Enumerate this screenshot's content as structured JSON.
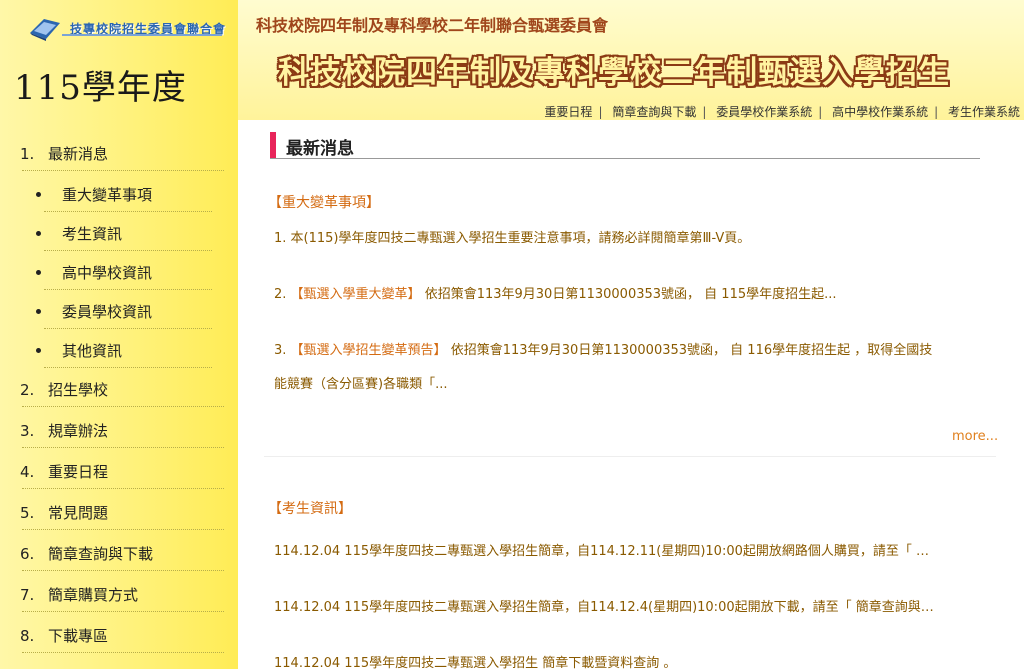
{
  "header": {
    "logo_text": "技專校院招生委員會聯合會",
    "org_title": "科技校院四年制及專科學校二年制聯合甄選委員會",
    "main_title": "科技校院四年制及專科學校二年制甄選入學招生",
    "top_links": [
      "重要日程",
      "簡章查詢與下載",
      "委員學校作業系統",
      "高中學校作業系統",
      "考生作業系統"
    ]
  },
  "sidebar": {
    "year": "115學年度",
    "items": [
      {
        "num": "1.",
        "label": "最新消息"
      },
      {
        "label": "重大變革事項"
      },
      {
        "label": "考生資訊"
      },
      {
        "label": "高中學校資訊"
      },
      {
        "label": "委員學校資訊"
      },
      {
        "label": "其他資訊"
      },
      {
        "num": "2.",
        "label": "招生學校"
      },
      {
        "num": "3.",
        "label": "規章辦法"
      },
      {
        "num": "4.",
        "label": "重要日程"
      },
      {
        "num": "5.",
        "label": "常見問題"
      },
      {
        "num": "6.",
        "label": "簡章查詢與下載"
      },
      {
        "num": "7.",
        "label": "簡章購買方式"
      },
      {
        "num": "8.",
        "label": "下載專區"
      }
    ]
  },
  "main": {
    "section_title": "最新消息",
    "major": {
      "heading": "【重大變革事項】",
      "items": [
        {
          "prefix": "1. ",
          "highlight": "",
          "text": "本(115)學年度四技二專甄選入學招生重要注意事項，請務必詳閱簡章第Ⅲ-V頁。"
        },
        {
          "prefix": "2. ",
          "highlight": "【甄選入學重大變革】",
          "text": " 依招策會113年9月30日第1130000353號函， 自 115學年度招生起..."
        },
        {
          "prefix": "3. ",
          "highlight": "【甄選入學招生變革預告】",
          "text": " 依招策會113年9月30日第1130000353號函， 自 116學年度招生起 ，取得全國技"
        },
        {
          "prefix": "",
          "highlight": "",
          "text": "能競賽（含分區賽)各職類「..."
        }
      ],
      "more": "more..."
    },
    "student": {
      "heading": "【考生資訊】",
      "items": [
        "114.12.04  115學年度四技二專甄選入學招生簡章，自114.12.11(星期四)10:00起開放網路個人購買，請至「 …",
        "114.12.04  115學年度四技二專甄選入學招生簡章，自114.12.4(星期四)10:00起開放下載，請至「 簡章查詢與…",
        "114.12.04  115學年度四技二專甄選入學招生 簡章下載暨資料查詢 。"
      ]
    }
  }
}
